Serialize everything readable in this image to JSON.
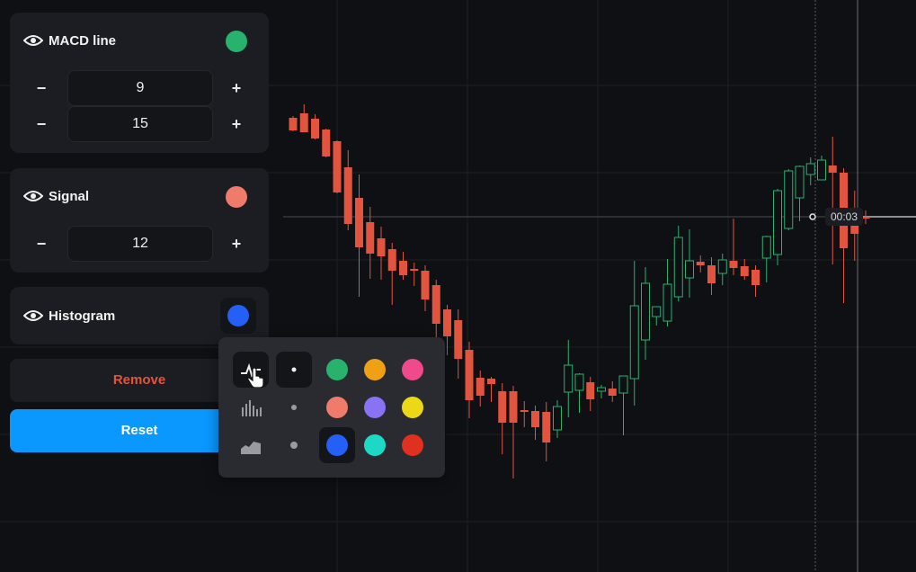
{
  "macd": {
    "title": "MACD line",
    "color": "#27b26e",
    "fast_period": "9",
    "slow_period": "15",
    "minus": "−",
    "plus": "+"
  },
  "signal": {
    "title": "Signal",
    "color": "#f07b6a",
    "period": "12",
    "minus": "−",
    "plus": "+"
  },
  "histogram": {
    "title": "Histogram",
    "color": "#2460f5"
  },
  "buttons": {
    "remove": "Remove",
    "reset": "Reset"
  },
  "color_picker": {
    "styles": [
      "line-style-icon",
      "histogram-style-icon",
      "area-style-icon"
    ],
    "thickness_dots": [
      "thick",
      "medium",
      "thin"
    ],
    "colors": [
      [
        "#27b26e",
        "#f0a015",
        "#f04a8c"
      ],
      [
        "#f07b6a",
        "#8a72f5",
        "#ecd816"
      ],
      [
        "#2460f5",
        "#1ed8c6",
        "#e0301f"
      ]
    ],
    "selected_color": "#2460f5"
  },
  "chart": {
    "time_label": "00:03",
    "up_color": "#27b26e",
    "down_color": "#e2543e"
  },
  "chart_data": {
    "type": "candlestick",
    "candles": [
      {
        "o": 131,
        "h": 129,
        "l": 146,
        "c": 145
      },
      {
        "o": 126,
        "h": 116,
        "l": 146,
        "c": 147
      },
      {
        "o": 132,
        "h": 127,
        "l": 155,
        "c": 154
      },
      {
        "o": 144,
        "h": 143,
        "l": 175,
        "c": 174
      },
      {
        "o": 157,
        "h": 156,
        "l": 215,
        "c": 214
      },
      {
        "o": 186,
        "h": 167,
        "l": 256,
        "c": 249
      },
      {
        "o": 220,
        "h": 194,
        "l": 330,
        "c": 275
      },
      {
        "o": 247,
        "h": 230,
        "l": 310,
        "c": 282
      },
      {
        "o": 265,
        "h": 252,
        "l": 311,
        "c": 285
      },
      {
        "o": 277,
        "h": 270,
        "l": 339,
        "c": 301
      },
      {
        "o": 290,
        "h": 280,
        "l": 311,
        "c": 306
      },
      {
        "o": 299,
        "h": 292,
        "l": 318,
        "c": 300
      },
      {
        "o": 301,
        "h": 295,
        "l": 346,
        "c": 333
      },
      {
        "o": 317,
        "h": 311,
        "l": 386,
        "c": 360
      },
      {
        "o": 344,
        "h": 339,
        "l": 395,
        "c": 374
      },
      {
        "o": 356,
        "h": 344,
        "l": 421,
        "c": 399
      },
      {
        "o": 389,
        "h": 380,
        "l": 465,
        "c": 445
      },
      {
        "o": 420,
        "h": 412,
        "l": 452,
        "c": 440
      },
      {
        "o": 421,
        "h": 419,
        "l": 447,
        "c": 427
      },
      {
        "o": 435,
        "h": 426,
        "l": 505,
        "c": 470
      },
      {
        "o": 435,
        "h": 429,
        "l": 532,
        "c": 470
      },
      {
        "o": 456,
        "h": 446,
        "l": 475,
        "c": 458
      },
      {
        "o": 457,
        "h": 451,
        "l": 489,
        "c": 475
      },
      {
        "o": 458,
        "h": 447,
        "l": 513,
        "c": 492
      },
      {
        "o": 478,
        "h": 445,
        "l": 487,
        "c": 452
      },
      {
        "o": 436,
        "h": 378,
        "l": 464,
        "c": 406
      },
      {
        "o": 434,
        "h": 415,
        "l": 459,
        "c": 416
      },
      {
        "o": 425,
        "h": 419,
        "l": 457,
        "c": 444
      },
      {
        "o": 435,
        "h": 428,
        "l": 443,
        "c": 431
      },
      {
        "o": 432,
        "h": 424,
        "l": 447,
        "c": 440
      },
      {
        "o": 437,
        "h": 418,
        "l": 484,
        "c": 418
      },
      {
        "o": 421,
        "h": 290,
        "l": 451,
        "c": 340
      },
      {
        "o": 378,
        "h": 297,
        "l": 400,
        "c": 315
      },
      {
        "o": 352,
        "h": 342,
        "l": 362,
        "c": 341
      },
      {
        "o": 357,
        "h": 288,
        "l": 363,
        "c": 316
      },
      {
        "o": 330,
        "h": 251,
        "l": 335,
        "c": 264
      },
      {
        "o": 309,
        "h": 255,
        "l": 331,
        "c": 290
      },
      {
        "o": 291,
        "h": 284,
        "l": 303,
        "c": 295
      },
      {
        "o": 295,
        "h": 286,
        "l": 328,
        "c": 315
      },
      {
        "o": 304,
        "h": 282,
        "l": 317,
        "c": 289
      },
      {
        "o": 290,
        "h": 243,
        "l": 306,
        "c": 298
      },
      {
        "o": 296,
        "h": 288,
        "l": 311,
        "c": 307
      },
      {
        "o": 300,
        "h": 295,
        "l": 330,
        "c": 317
      },
      {
        "o": 287,
        "h": 262,
        "l": 314,
        "c": 263
      },
      {
        "o": 283,
        "h": 210,
        "l": 295,
        "c": 212
      },
      {
        "o": 254,
        "h": 188,
        "l": 256,
        "c": 190
      },
      {
        "o": 220,
        "h": 184,
        "l": 246,
        "c": 185
      },
      {
        "o": 194,
        "h": 175,
        "l": 206,
        "c": 182
      },
      {
        "o": 200,
        "h": 173,
        "l": 200,
        "c": 178
      },
      {
        "o": 184,
        "h": 152,
        "l": 294,
        "c": 192
      },
      {
        "o": 192,
        "h": 187,
        "l": 337,
        "c": 276
      },
      {
        "o": 235,
        "h": 212,
        "l": 290,
        "c": 260
      },
      {
        "o": 241,
        "h": 234,
        "l": 249,
        "c": 241
      }
    ]
  }
}
